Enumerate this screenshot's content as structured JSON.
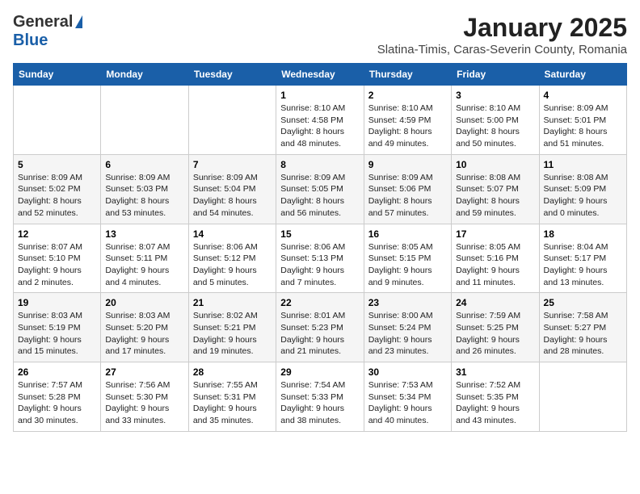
{
  "logo": {
    "general": "General",
    "blue": "Blue"
  },
  "title": "January 2025",
  "subtitle": "Slatina-Timis, Caras-Severin County, Romania",
  "weekdays": [
    "Sunday",
    "Monday",
    "Tuesday",
    "Wednesday",
    "Thursday",
    "Friday",
    "Saturday"
  ],
  "weeks": [
    [
      {
        "day": "",
        "info": ""
      },
      {
        "day": "",
        "info": ""
      },
      {
        "day": "",
        "info": ""
      },
      {
        "day": "1",
        "info": "Sunrise: 8:10 AM\nSunset: 4:58 PM\nDaylight: 8 hours and 48 minutes."
      },
      {
        "day": "2",
        "info": "Sunrise: 8:10 AM\nSunset: 4:59 PM\nDaylight: 8 hours and 49 minutes."
      },
      {
        "day": "3",
        "info": "Sunrise: 8:10 AM\nSunset: 5:00 PM\nDaylight: 8 hours and 50 minutes."
      },
      {
        "day": "4",
        "info": "Sunrise: 8:09 AM\nSunset: 5:01 PM\nDaylight: 8 hours and 51 minutes."
      }
    ],
    [
      {
        "day": "5",
        "info": "Sunrise: 8:09 AM\nSunset: 5:02 PM\nDaylight: 8 hours and 52 minutes."
      },
      {
        "day": "6",
        "info": "Sunrise: 8:09 AM\nSunset: 5:03 PM\nDaylight: 8 hours and 53 minutes."
      },
      {
        "day": "7",
        "info": "Sunrise: 8:09 AM\nSunset: 5:04 PM\nDaylight: 8 hours and 54 minutes."
      },
      {
        "day": "8",
        "info": "Sunrise: 8:09 AM\nSunset: 5:05 PM\nDaylight: 8 hours and 56 minutes."
      },
      {
        "day": "9",
        "info": "Sunrise: 8:09 AM\nSunset: 5:06 PM\nDaylight: 8 hours and 57 minutes."
      },
      {
        "day": "10",
        "info": "Sunrise: 8:08 AM\nSunset: 5:07 PM\nDaylight: 8 hours and 59 minutes."
      },
      {
        "day": "11",
        "info": "Sunrise: 8:08 AM\nSunset: 5:09 PM\nDaylight: 9 hours and 0 minutes."
      }
    ],
    [
      {
        "day": "12",
        "info": "Sunrise: 8:07 AM\nSunset: 5:10 PM\nDaylight: 9 hours and 2 minutes."
      },
      {
        "day": "13",
        "info": "Sunrise: 8:07 AM\nSunset: 5:11 PM\nDaylight: 9 hours and 4 minutes."
      },
      {
        "day": "14",
        "info": "Sunrise: 8:06 AM\nSunset: 5:12 PM\nDaylight: 9 hours and 5 minutes."
      },
      {
        "day": "15",
        "info": "Sunrise: 8:06 AM\nSunset: 5:13 PM\nDaylight: 9 hours and 7 minutes."
      },
      {
        "day": "16",
        "info": "Sunrise: 8:05 AM\nSunset: 5:15 PM\nDaylight: 9 hours and 9 minutes."
      },
      {
        "day": "17",
        "info": "Sunrise: 8:05 AM\nSunset: 5:16 PM\nDaylight: 9 hours and 11 minutes."
      },
      {
        "day": "18",
        "info": "Sunrise: 8:04 AM\nSunset: 5:17 PM\nDaylight: 9 hours and 13 minutes."
      }
    ],
    [
      {
        "day": "19",
        "info": "Sunrise: 8:03 AM\nSunset: 5:19 PM\nDaylight: 9 hours and 15 minutes."
      },
      {
        "day": "20",
        "info": "Sunrise: 8:03 AM\nSunset: 5:20 PM\nDaylight: 9 hours and 17 minutes."
      },
      {
        "day": "21",
        "info": "Sunrise: 8:02 AM\nSunset: 5:21 PM\nDaylight: 9 hours and 19 minutes."
      },
      {
        "day": "22",
        "info": "Sunrise: 8:01 AM\nSunset: 5:23 PM\nDaylight: 9 hours and 21 minutes."
      },
      {
        "day": "23",
        "info": "Sunrise: 8:00 AM\nSunset: 5:24 PM\nDaylight: 9 hours and 23 minutes."
      },
      {
        "day": "24",
        "info": "Sunrise: 7:59 AM\nSunset: 5:25 PM\nDaylight: 9 hours and 26 minutes."
      },
      {
        "day": "25",
        "info": "Sunrise: 7:58 AM\nSunset: 5:27 PM\nDaylight: 9 hours and 28 minutes."
      }
    ],
    [
      {
        "day": "26",
        "info": "Sunrise: 7:57 AM\nSunset: 5:28 PM\nDaylight: 9 hours and 30 minutes."
      },
      {
        "day": "27",
        "info": "Sunrise: 7:56 AM\nSunset: 5:30 PM\nDaylight: 9 hours and 33 minutes."
      },
      {
        "day": "28",
        "info": "Sunrise: 7:55 AM\nSunset: 5:31 PM\nDaylight: 9 hours and 35 minutes."
      },
      {
        "day": "29",
        "info": "Sunrise: 7:54 AM\nSunset: 5:33 PM\nDaylight: 9 hours and 38 minutes."
      },
      {
        "day": "30",
        "info": "Sunrise: 7:53 AM\nSunset: 5:34 PM\nDaylight: 9 hours and 40 minutes."
      },
      {
        "day": "31",
        "info": "Sunrise: 7:52 AM\nSunset: 5:35 PM\nDaylight: 9 hours and 43 minutes."
      },
      {
        "day": "",
        "info": ""
      }
    ]
  ]
}
